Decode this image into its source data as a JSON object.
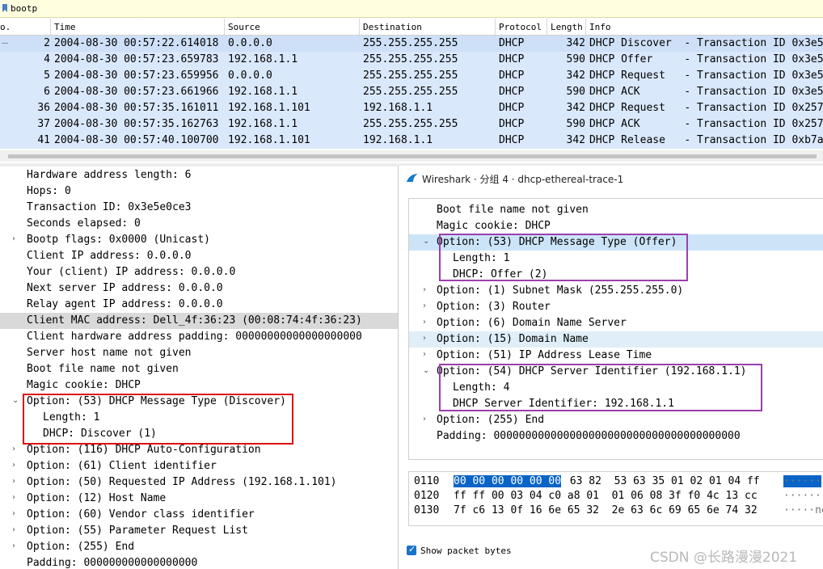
{
  "filter": {
    "text": "bootp"
  },
  "packet_list": {
    "columns": [
      "o.",
      "Time",
      "Source",
      "Destination",
      "Protocol",
      "Length",
      "Info"
    ],
    "rows": [
      {
        "no": "2",
        "time": "2004-08-30 00:57:22.614018",
        "src": "0.0.0.0",
        "dst": "255.255.255.255",
        "proto": "DHCP",
        "len": "342",
        "info": "DHCP Discover  - Transaction ID 0x3e5"
      },
      {
        "no": "4",
        "time": "2004-08-30 00:57:23.659783",
        "src": "192.168.1.1",
        "dst": "255.255.255.255",
        "proto": "DHCP",
        "len": "590",
        "info": "DHCP Offer     - Transaction ID 0x3e5"
      },
      {
        "no": "5",
        "time": "2004-08-30 00:57:23.659956",
        "src": "0.0.0.0",
        "dst": "255.255.255.255",
        "proto": "DHCP",
        "len": "342",
        "info": "DHCP Request   - Transaction ID 0x3e5"
      },
      {
        "no": "6",
        "time": "2004-08-30 00:57:23.661966",
        "src": "192.168.1.1",
        "dst": "255.255.255.255",
        "proto": "DHCP",
        "len": "590",
        "info": "DHCP ACK       - Transaction ID 0x3e5"
      },
      {
        "no": "36",
        "time": "2004-08-30 00:57:35.161011",
        "src": "192.168.1.101",
        "dst": "192.168.1.1",
        "proto": "DHCP",
        "len": "342",
        "info": "DHCP Request   - Transaction ID 0x257"
      },
      {
        "no": "37",
        "time": "2004-08-30 00:57:35.162763",
        "src": "192.168.1.1",
        "dst": "255.255.255.255",
        "proto": "DHCP",
        "len": "590",
        "info": "DHCP ACK       - Transaction ID 0x257"
      },
      {
        "no": "41",
        "time": "2004-08-30 00:57:40.100700",
        "src": "192.168.1.101",
        "dst": "192.168.1.1",
        "proto": "DHCP",
        "len": "342",
        "info": "DHCP Release   - Transaction ID 0xb7a"
      }
    ]
  },
  "details": [
    {
      "text": "Hardware address length: 6",
      "arrow": ""
    },
    {
      "text": "Hops: 0",
      "arrow": ""
    },
    {
      "text": "Transaction ID: 0x3e5e0ce3",
      "arrow": ""
    },
    {
      "text": "Seconds elapsed: 0",
      "arrow": ""
    },
    {
      "text": "Bootp flags: 0x0000 (Unicast)",
      "arrow": "›"
    },
    {
      "text": "Client IP address: 0.0.0.0",
      "arrow": ""
    },
    {
      "text": "Your (client) IP address: 0.0.0.0",
      "arrow": ""
    },
    {
      "text": "Next server IP address: 0.0.0.0",
      "arrow": ""
    },
    {
      "text": "Relay agent IP address: 0.0.0.0",
      "arrow": ""
    },
    {
      "text": "Client MAC address: Dell_4f:36:23 (00:08:74:4f:36:23)",
      "arrow": ""
    },
    {
      "text": "Client hardware address padding: 00000000000000000000",
      "arrow": ""
    },
    {
      "text": "Server host name not given",
      "arrow": ""
    },
    {
      "text": "Boot file name not given",
      "arrow": ""
    },
    {
      "text": "Magic cookie: DHCP",
      "arrow": ""
    },
    {
      "text": "Option: (53) DHCP Message Type (Discover)",
      "arrow": "⌄"
    },
    {
      "text": "Length: 1",
      "arrow": ""
    },
    {
      "text": "DHCP: Discover (1)",
      "arrow": ""
    },
    {
      "text": "Option: (116) DHCP Auto-Configuration",
      "arrow": "›"
    },
    {
      "text": "Option: (61) Client identifier",
      "arrow": "›"
    },
    {
      "text": "Option: (50) Requested IP Address (192.168.1.101)",
      "arrow": "›"
    },
    {
      "text": "Option: (12) Host Name",
      "arrow": "›"
    },
    {
      "text": "Option: (60) Vendor class identifier",
      "arrow": "›"
    },
    {
      "text": "Option: (55) Parameter Request List",
      "arrow": "›"
    },
    {
      "text": "Option: (255) End",
      "arrow": "›"
    },
    {
      "text": "Padding: 000000000000000000",
      "arrow": ""
    }
  ],
  "popup": {
    "title": "Wireshark · 分组 4 · dhcp-ethereal-trace-1",
    "tree": [
      {
        "text": "Boot file name not given",
        "arrow": ""
      },
      {
        "text": "Magic cookie: DHCP",
        "arrow": ""
      },
      {
        "text": "Option: (53) DHCP Message Type (Offer)",
        "arrow": "⌄"
      },
      {
        "text": "Length: 1",
        "arrow": ""
      },
      {
        "text": "DHCP: Offer (2)",
        "arrow": ""
      },
      {
        "text": "Option: (1) Subnet Mask (255.255.255.0)",
        "arrow": "›"
      },
      {
        "text": "Option: (3) Router",
        "arrow": "›"
      },
      {
        "text": "Option: (6) Domain Name Server",
        "arrow": "›"
      },
      {
        "text": "Option: (15) Domain Name",
        "arrow": "›"
      },
      {
        "text": "Option: (51) IP Address Lease Time",
        "arrow": "›"
      },
      {
        "text": "Option: (54) DHCP Server Identifier (192.168.1.1)",
        "arrow": "⌄"
      },
      {
        "text": "Length: 4",
        "arrow": ""
      },
      {
        "text": "DHCP Server Identifier: 192.168.1.1",
        "arrow": ""
      },
      {
        "text": "Option: (255) End",
        "arrow": "›"
      },
      {
        "text": "Padding: 000000000000000000000000000000000000000",
        "arrow": ""
      }
    ],
    "bytes": [
      {
        "offset": "0110",
        "sel": "00 00 00 00 00 00",
        "rest": " 63 82  53 63 35 01 02 01 04 ff",
        "ascii": "······"
      },
      {
        "offset": "0120",
        "sel": "",
        "rest": "ff ff 00 03 04 c0 a8 01  01 06 08 3f f0 4c 13 cc",
        "ascii": "······"
      },
      {
        "offset": "0130",
        "sel": "",
        "rest": "7f c6 13 0f 16 6e 65 32  2e 63 6c 69 65 6e 74 32",
        "ascii": "·····ne"
      }
    ],
    "show_bytes_label": "Show packet bytes",
    "show_bytes_checked": true
  },
  "watermark": "CSDN @长路漫漫2021",
  "colors": {
    "row_bg": "#dae8fb",
    "filter_bg": "#ffffe0",
    "red_box": "#d11111",
    "purple_box": "#9b3fae",
    "byte_sel": "#0a64c8"
  }
}
